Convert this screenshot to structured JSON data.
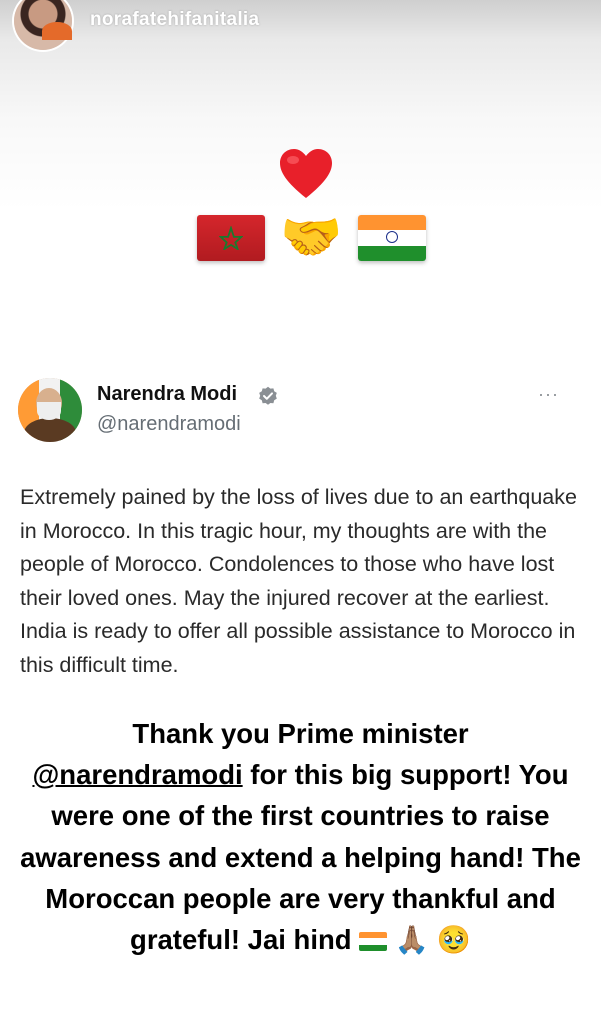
{
  "story": {
    "username": "norafatehifanitalia",
    "avatar_icon": "profile-avatar",
    "stickers": {
      "heart_icon": "red-heart-icon",
      "left_flag_icon": "morocco-flag-icon",
      "center_icon": "handshake-icon",
      "center_glyph": "🤝",
      "right_flag_icon": "india-flag-icon"
    }
  },
  "tweet": {
    "name": "Narendra Modi",
    "handle": "@narendramodi",
    "verified_icon": "verified-badge-icon",
    "more_label": "···",
    "text": "Extremely pained by the loss of lives due to an earthquake in Morocco. In this tragic hour, my thoughts are with the people of Morocco. Condolences to those who have lost their loved ones. May the injured recover at the earliest. India is ready to offer all possible assistance to Morocco in this difficult time."
  },
  "caption": {
    "line_start": "Thank you Prime minister",
    "mention": "@narendramodi",
    "line_rest": "for this big support! You were one of the first countries to raise awareness and extend a helping hand! The Moroccan people are very thankful and grateful! Jai hind",
    "emoji_pray": "🙏🏽",
    "emoji_face": "🥹",
    "trailing_icons": [
      "india-flag-icon",
      "folded-hands-icon",
      "pleading-face-icon"
    ]
  },
  "colors": {
    "handle_gray": "#666e75",
    "verified_gray": "#8a8f94",
    "heart_red": "#e8202a"
  }
}
